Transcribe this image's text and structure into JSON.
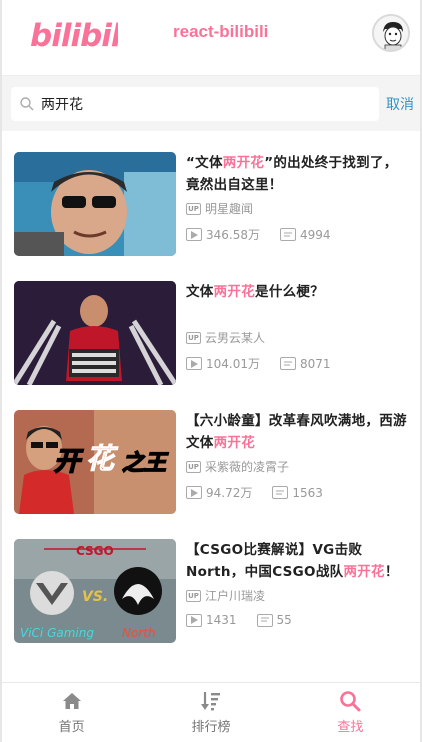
{
  "header": {
    "logo_text": "bilibili",
    "app_title": "react-bilibili"
  },
  "search": {
    "query": "两开花",
    "cancel_label": "取消"
  },
  "colors": {
    "accent": "#fb7299",
    "link": "#2e94c9",
    "muted": "#999999"
  },
  "videos": [
    {
      "title_parts": [
        "“文体",
        "两开花",
        "”的出处终于找到了，竟然出自这里！"
      ],
      "uploader": "明星趣闻",
      "plays": "346.58万",
      "danmaku": "4994"
    },
    {
      "title_parts": [
        "文体",
        "两开花",
        "是什么梗？"
      ],
      "uploader": "云男云某人",
      "plays": "104.01万",
      "danmaku": "8071"
    },
    {
      "title_parts": [
        "【六小龄童】改革春风吹满地，西游文体",
        "两开花",
        ""
      ],
      "uploader": "采紫薇的凌霄子",
      "plays": "94.72万",
      "danmaku": "1563"
    },
    {
      "title_parts": [
        "【CSGO比赛解说】VG击败North，中国CSGO战队",
        "两开花",
        "！"
      ],
      "uploader": "江户川瑞凌",
      "plays": "1431",
      "danmaku": "55"
    }
  ],
  "tabs": [
    {
      "label": "首页",
      "icon": "home-icon",
      "active": false
    },
    {
      "label": "排行榜",
      "icon": "rank-icon",
      "active": false
    },
    {
      "label": "查找",
      "icon": "search-icon",
      "active": true
    }
  ]
}
